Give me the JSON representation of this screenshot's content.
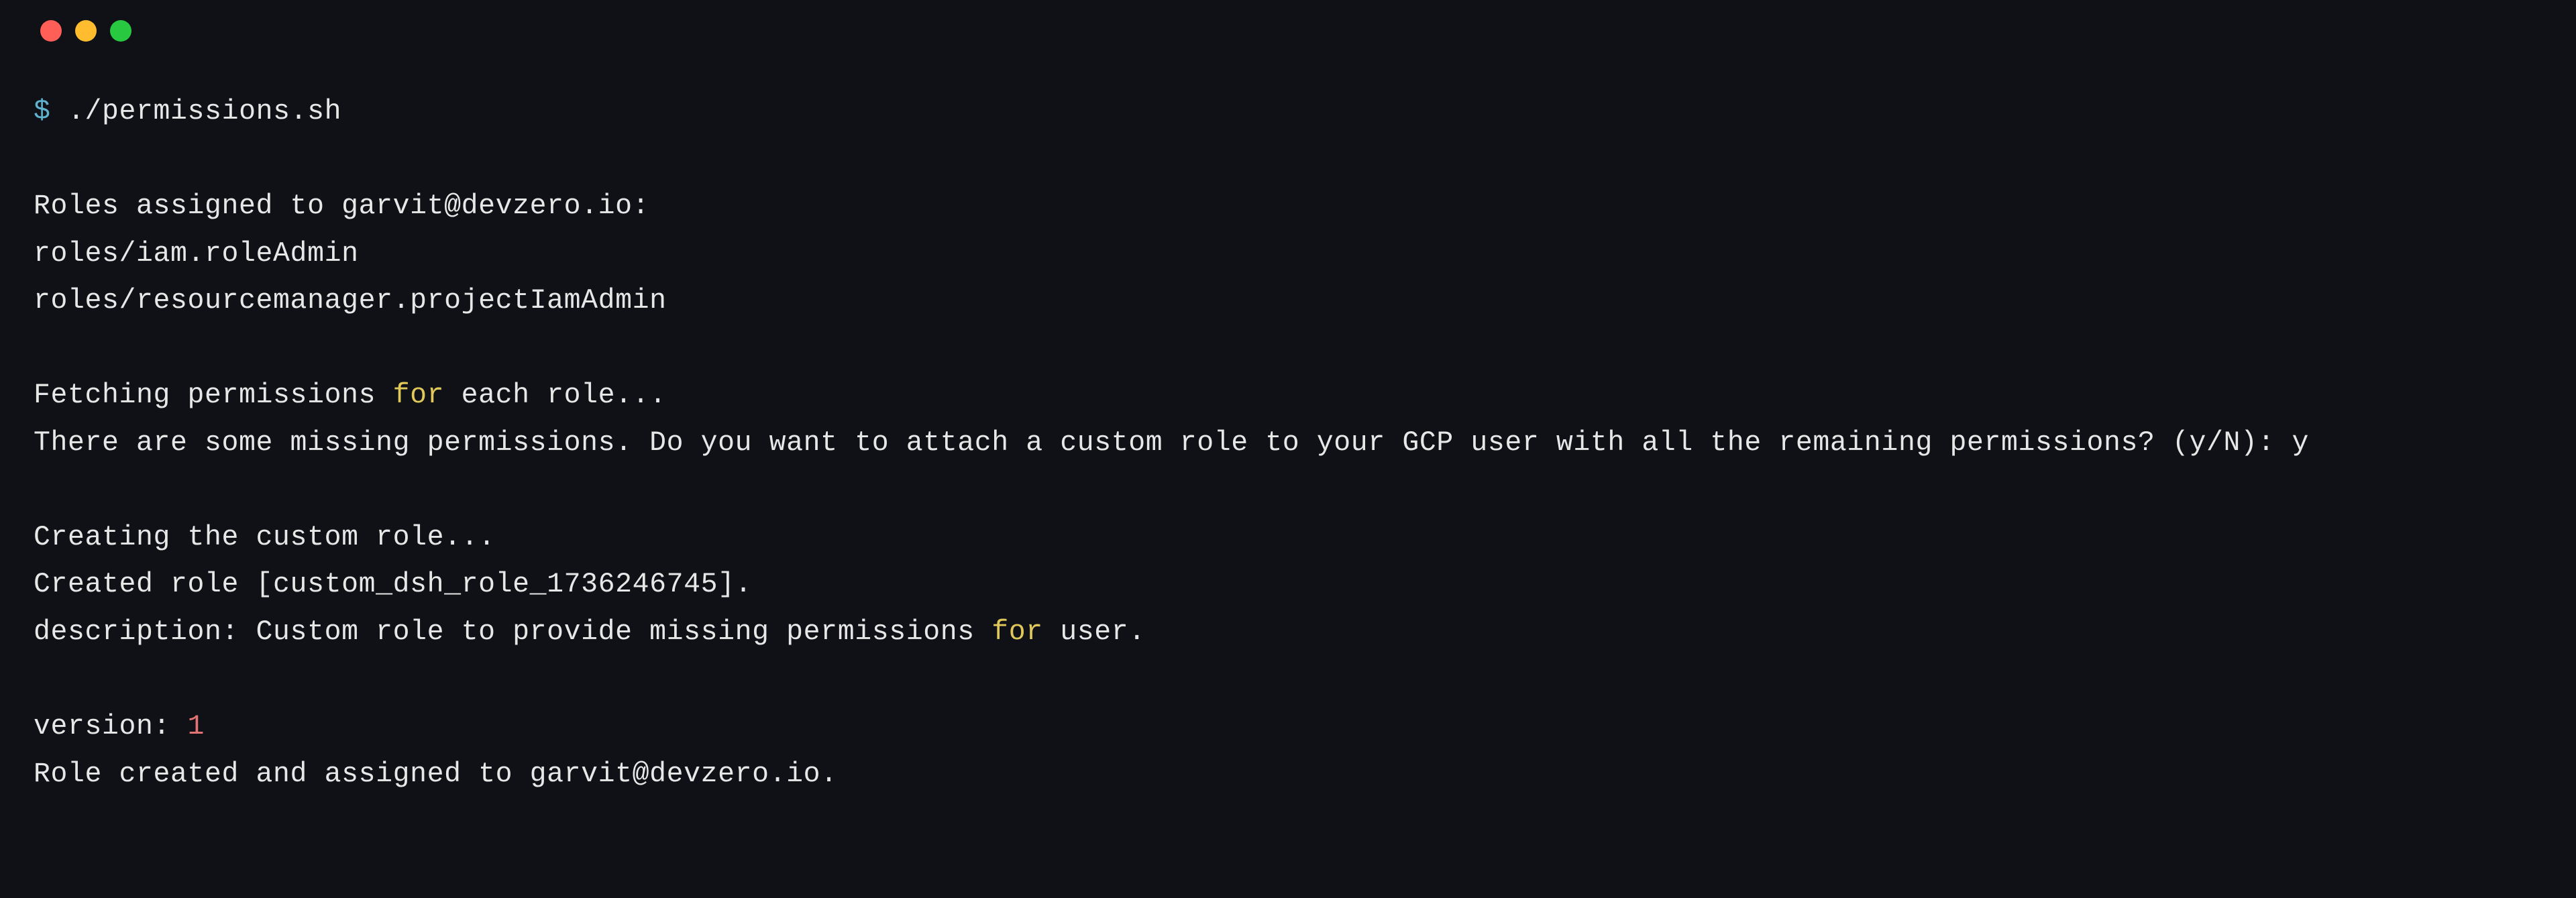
{
  "colors": {
    "bg": "#0f1116",
    "text": "#e7e7e7",
    "prompt": "#5fb3cf",
    "keyword": "#e0c95a",
    "number": "#e27373",
    "traffic_red": "#ff5f57",
    "traffic_yellow": "#febc2e",
    "traffic_green": "#28c840"
  },
  "prompt_symbol": "$",
  "command": "./permissions.sh",
  "output": {
    "roles_header": "Roles assigned to garvit@devzero.io:",
    "roles": [
      "roles/iam.roleAdmin",
      "roles/resourcemanager.projectIamAdmin"
    ],
    "fetch_line_pre": "Fetching permissions ",
    "fetch_line_kw": "for",
    "fetch_line_post": " each role...",
    "missing_prompt_text": "There are some missing permissions. Do you want to attach a custom role to your GCP user with all the remaining permissions? (y/N): ",
    "missing_prompt_answer": "y",
    "creating_line": "Creating the custom role...",
    "created_line": "Created role [custom_dsh_role_1736246745].",
    "desc_pre": "description: Custom role to provide missing permissions ",
    "desc_kw": "for",
    "desc_post": " user.",
    "version_label": "version: ",
    "version_value": "1",
    "assigned_line": "Role created and assigned to garvit@devzero.io."
  }
}
